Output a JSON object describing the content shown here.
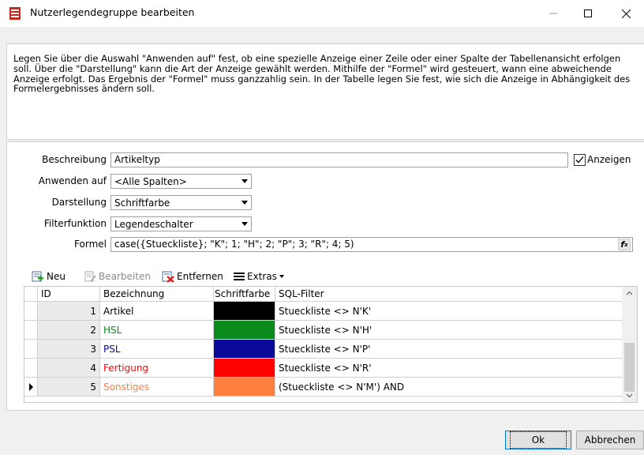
{
  "window": {
    "title": "Nutzerlegendegruppe bearbeiten"
  },
  "info": {
    "text": "Legen Sie über die Auswahl \"Anwenden auf\" fest, ob eine spezielle Anzeige einer Zeile oder einer Spalte der Tabellenansicht erfolgen soll. Über die \"Darstellung\" kann die Art der Anzeige gewählt werden. Mithilfe der \"Formel\" wird gesteuert, wann eine abweichende Anzeige erfolgt. Das Ergebnis der \"Formel\" muss ganzzahlig sein. In der Tabelle legen Sie fest, wie sich die Anzeige in Abhängigkeit des Formelergebnisses ändern soll."
  },
  "form": {
    "beschreibung_label": "Beschreibung",
    "beschreibung_value": "Artikeltyp",
    "anzeigen_label": "Anzeigen",
    "anwenden_label": "Anwenden auf",
    "anwenden_value": "<Alle Spalten>",
    "darstellung_label": "Darstellung",
    "darstellung_value": "Schriftfarbe",
    "filter_label": "Filterfunktion",
    "filter_value": "Legendeschalter",
    "formel_label": "Formel",
    "formel_value": "case({Stueckliste}; \"K\"; 1; \"H\"; 2; \"P\"; 3; \"R\"; 4; 5)"
  },
  "toolbar": {
    "neu": "Neu",
    "bearbeiten": "Bearbeiten",
    "entfernen": "Entfernen",
    "extras": "Extras"
  },
  "grid": {
    "headers": [
      "ID",
      "Bezeichnung",
      "Schriftfarbe",
      "SQL-Filter"
    ],
    "rows": [
      {
        "id": "1",
        "name": "Artikel",
        "color": "#000000",
        "text_color": "#000000",
        "filter": "Stueckliste <> N'K'"
      },
      {
        "id": "2",
        "name": "HSL",
        "color": "#0a8a1a",
        "text_color": "#0a8a1a",
        "filter": "Stueckliste <> N'H'"
      },
      {
        "id": "3",
        "name": "PSL",
        "color": "#0a0a9a",
        "text_color": "#0a0a9a",
        "filter": "Stueckliste <> N'P'"
      },
      {
        "id": "4",
        "name": "Fertigung",
        "color": "#ff0000",
        "text_color": "#ff0000",
        "filter": "Stueckliste <> N'R'"
      },
      {
        "id": "5",
        "name": "Sonstiges",
        "color": "#ff7f40",
        "text_color": "#ff7f40",
        "filter": "(Stueckliste <> N'M') AND"
      }
    ]
  },
  "buttons": {
    "ok": "Ok",
    "abbrechen": "Abbrechen"
  }
}
